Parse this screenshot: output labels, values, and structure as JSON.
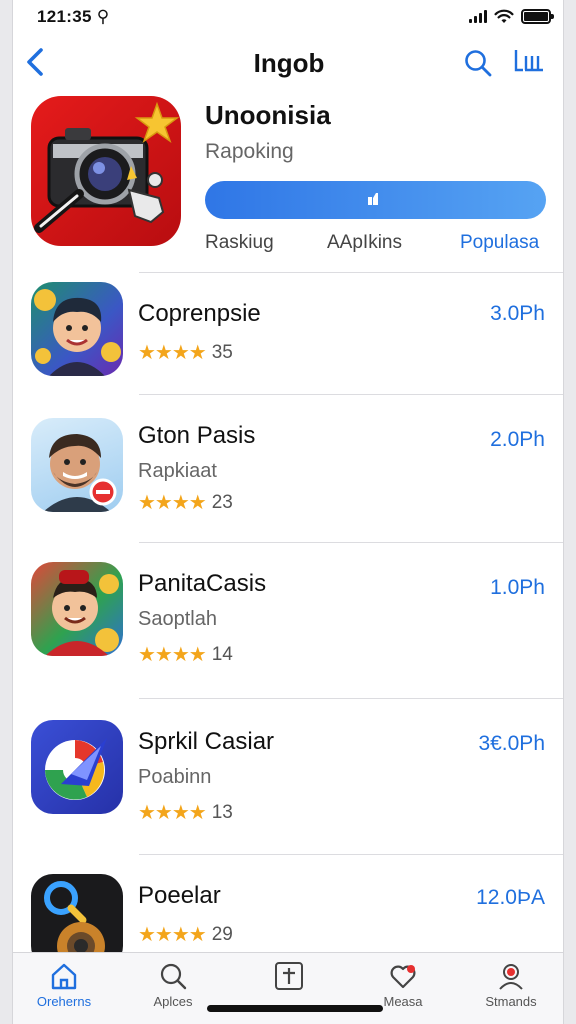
{
  "status_bar": {
    "time": "121:35 ⚲"
  },
  "nav": {
    "title": "Ingob"
  },
  "featured": {
    "name": "Unoonisia",
    "subtitle": "Rapoking",
    "tabs": [
      "Raskiug",
      "AApIkins",
      "Populasa"
    ]
  },
  "apps": [
    {
      "name": "Coprenpsie",
      "subtitle": "",
      "stars": "★★★★",
      "rating_count": "35",
      "price": "3.0Ph"
    },
    {
      "name": "Gton Pasis",
      "subtitle": "Rapkiaat",
      "stars": "★★★★",
      "rating_count": "23",
      "price": "2.0Ph"
    },
    {
      "name": "PanitaCasis",
      "subtitle": "Saoptlah",
      "stars": "★★★★",
      "rating_count": "14",
      "price": "1.0Ph"
    },
    {
      "name": "Sprkil Casiar",
      "subtitle": "Poabinn",
      "stars": "★★★★",
      "rating_count": "13",
      "price": "3€.0Ph"
    },
    {
      "name": "Poeelar",
      "subtitle": "",
      "stars": "★★★★",
      "rating_count": "29",
      "price": "12.0ÞA"
    }
  ],
  "tab_bar": {
    "items": [
      "Oreherns",
      "Aplces",
      "",
      "Measa",
      "Stmands"
    ]
  },
  "colors": {
    "accent": "#1f6fde",
    "star": "#f3a51b",
    "featured_icon_bg": "#d9161a"
  }
}
